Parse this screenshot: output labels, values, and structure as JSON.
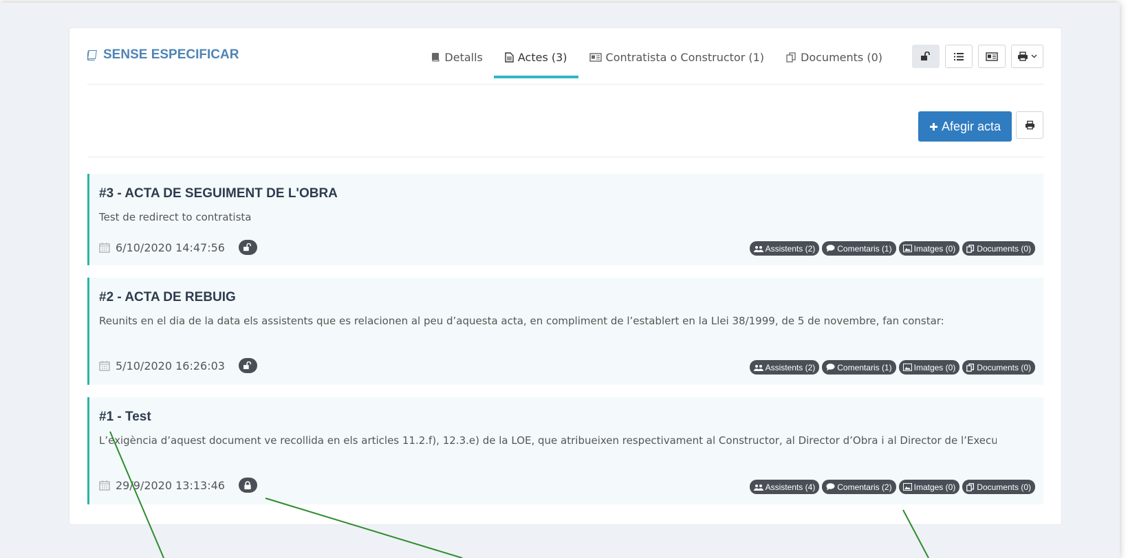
{
  "header": {
    "title": "SENSE ESPECIFICAR",
    "tabs": [
      {
        "label": "Detalls"
      },
      {
        "label": "Actes (3)"
      },
      {
        "label": "Contratista o Constructor (1)"
      },
      {
        "label": "Documents (0)"
      }
    ]
  },
  "actions": {
    "add_label": "Afegir acta"
  },
  "actes": [
    {
      "title": "#3 - ACTA DE SEGUIMENT DE L'OBRA",
      "description": "Test de redirect to contratista",
      "date": "6/10/2020 14:47:56",
      "locked": false,
      "assistents": "Assistents (2)",
      "comentaris": "Comentaris (1)",
      "imatges": "Imatges (0)",
      "documents": "Documents (0)"
    },
    {
      "title": "#2 - ACTA DE REBUIG",
      "description": "Reunits en el dia de la data els assistents que es relacionen al peu d’aquesta acta, en compliment de l’establert en la Llei 38/1999, de 5 de novembre, fan constar:",
      "date": "5/10/2020 16:26:03",
      "locked": false,
      "assistents": "Assistents (2)",
      "comentaris": "Comentaris (1)",
      "imatges": "Imatges (0)",
      "documents": "Documents (0)"
    },
    {
      "title": "#1 - Test",
      "description": "L’exigència d’aquest document ve recollida en els articles 11.2.f), 12.3.e) de la LOE, que atribueixen respectivament al Constructor, al Director d’Obra i al Director de l’Execució de l’",
      "date": "29/9/2020 13:13:46",
      "locked": true,
      "assistents": "Assistents (4)",
      "comentaris": "Comentaris (2)",
      "imatges": "Imatges (0)",
      "documents": "Documents (0)"
    }
  ],
  "colors": {
    "accent": "#2fb8c4",
    "primary_button": "#2f7cc0",
    "title": "#4f84b5",
    "card_border": "#29b5a6",
    "badge": "#4a4f57",
    "annotation_lines": "#2e8b2e"
  }
}
